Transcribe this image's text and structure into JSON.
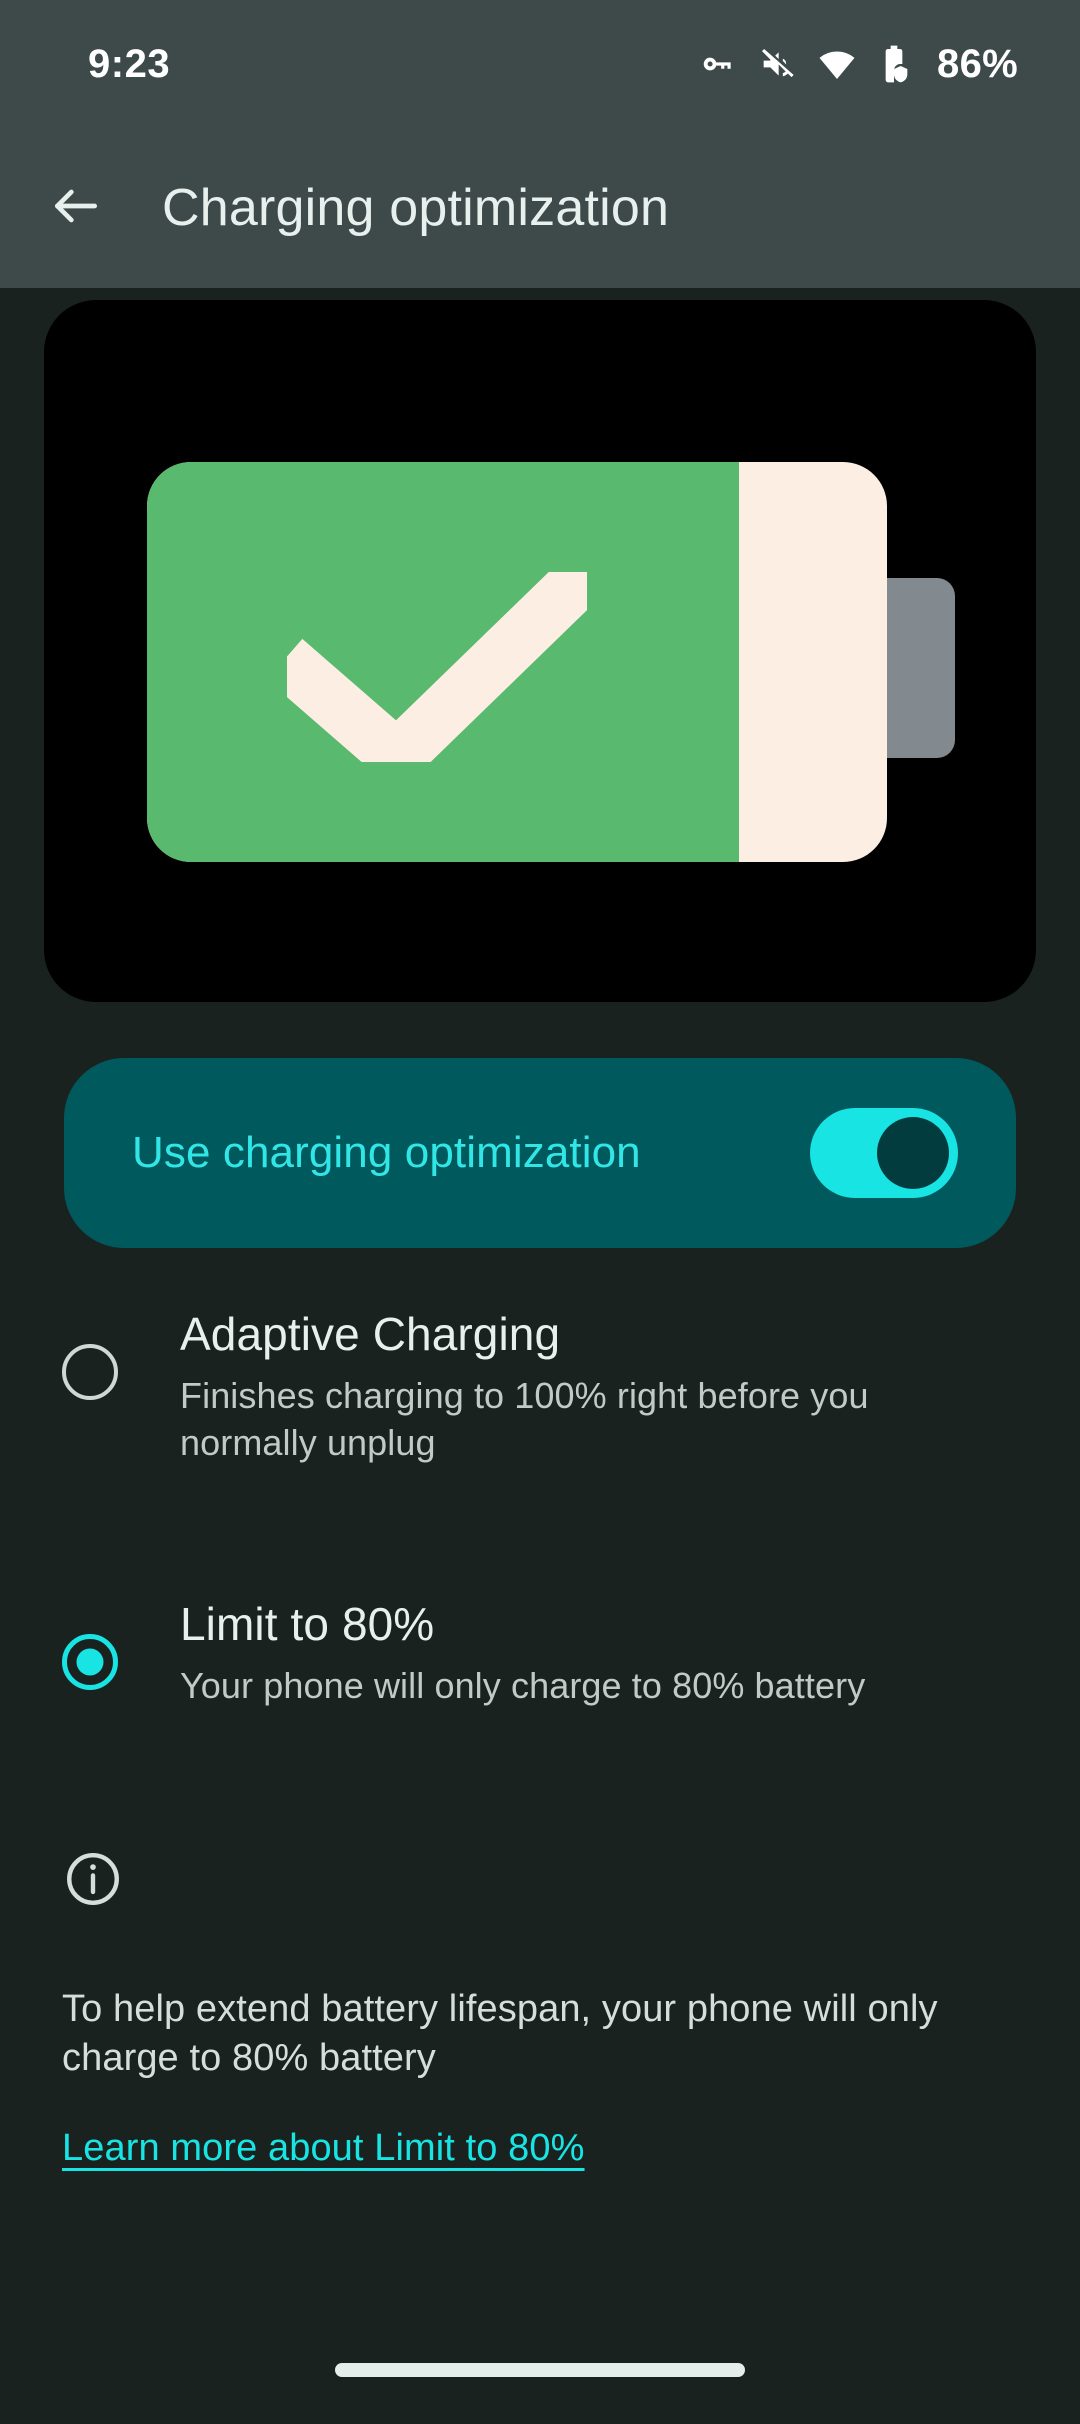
{
  "status_bar": {
    "time": "9:23",
    "battery_percent": "86%",
    "icons": [
      "vpn-key-icon",
      "volume-muted-icon",
      "wifi-icon",
      "battery-protected-icon"
    ]
  },
  "app_bar": {
    "back_icon": "back-arrow-icon",
    "title": "Charging optimization"
  },
  "illustration": {
    "name": "battery-check-illustration",
    "battery_fill_color": "#59b96f",
    "battery_body_color": "#fdeee3",
    "battery_tip_color": "#82898f",
    "background_color": "#000000",
    "fill_fraction": 0.8
  },
  "toggle": {
    "label": "Use charging optimization",
    "state": "on",
    "card_color": "#00595c",
    "accent_color": "#18e4e4",
    "label_color": "#30e6e6"
  },
  "options": [
    {
      "title": "Adaptive Charging",
      "description": "Finishes charging to 100% right before you normally unplug",
      "selected": false
    },
    {
      "title": "Limit to 80%",
      "description": "Your phone will only charge to 80% battery",
      "selected": true
    }
  ],
  "info": {
    "icon": "info-circle-icon",
    "text": "To help extend battery lifespan, your phone will only charge to 80% battery",
    "link": "Learn more about Limit to 80%",
    "link_color": "#18e4e4"
  },
  "nav_bar": {
    "handle": "home-gesture-handle"
  },
  "theme": {
    "background": "#1a2220",
    "app_bar": "#3d4a49",
    "accent": "#18e4e4",
    "text_primary": "#e8f0ee",
    "text_secondary": "#c0cbc8"
  }
}
